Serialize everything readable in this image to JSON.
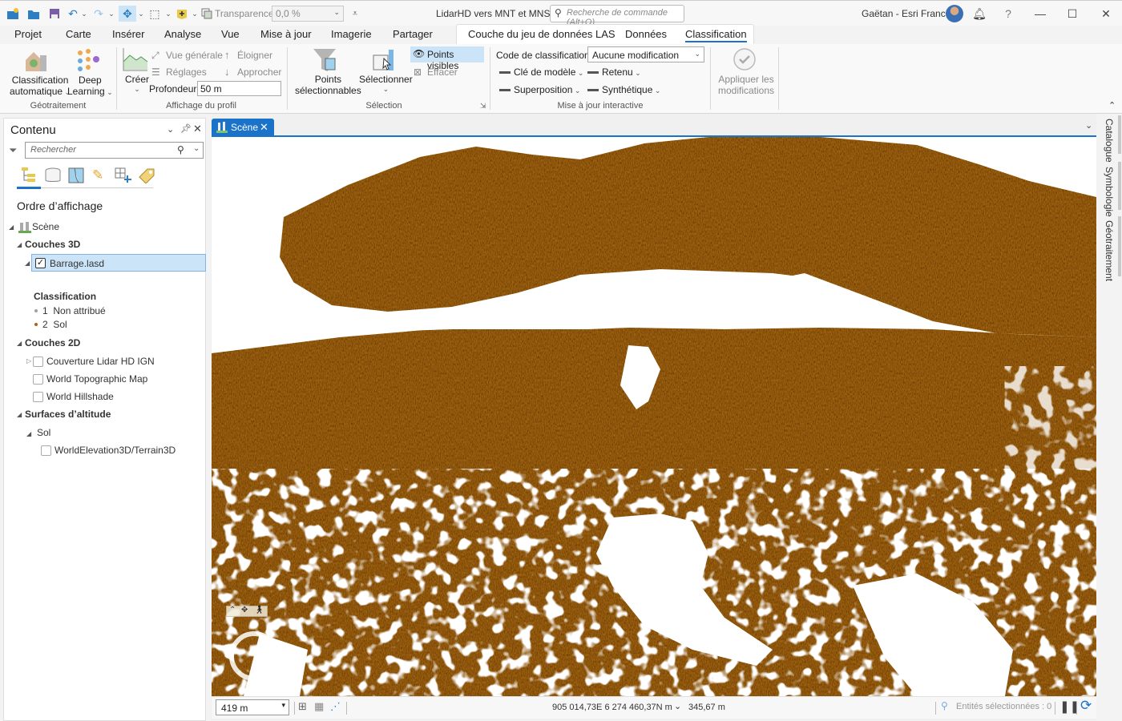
{
  "titlebar": {
    "app_title": "LidarHD vers MNT et MNS",
    "command_search_placeholder": "Recherche de commande (Alt+Q)",
    "transparency_label": "Transparence",
    "transparency_value": "0,0 %",
    "user_name": "Gaëtan - Esri France",
    "icons": [
      "new-project-icon",
      "open-project-icon",
      "save-project-icon",
      "undo-icon",
      "redo-icon",
      "explore-navigate-icon",
      "select-icon",
      "add-data-icon",
      "transparency-icon",
      "customize-toolbar-icon",
      "notifications-icon",
      "help-icon",
      "minimize-icon",
      "maximize-icon",
      "close-icon"
    ]
  },
  "tabs": {
    "main": [
      "Projet",
      "Carte",
      "Insérer",
      "Analyse",
      "Vue",
      "Mise à jour",
      "Imagerie",
      "Partager"
    ],
    "contextual": [
      "Couche du jeu de données LAS",
      "Données",
      "Classification"
    ],
    "active": "Classification"
  },
  "ribbon": {
    "geotraitement": {
      "title": "Géotraitement",
      "classif_auto_1": "Classification",
      "classif_auto_2": "automatique",
      "deep_1": "Deep",
      "deep_2": "Learning"
    },
    "profil": {
      "title": "Affichage du profil",
      "creer": "Créer",
      "vue_generale": "Vue générale",
      "reglages": "Réglages",
      "eloigner": "Éloigner",
      "approcher": "Approcher",
      "profondeur_label": "Profondeur",
      "profondeur_value": "50 m"
    },
    "selection": {
      "title": "Sélection",
      "points_sel_1": "Points",
      "points_sel_2": "sélectionnables",
      "selectionner": "Sélectionner",
      "points_visibles": "Points visibles",
      "effacer": "Effacer"
    },
    "maj": {
      "title": "Mise à jour interactive",
      "code_label": "Code de classification",
      "code_value": "Aucune modification",
      "cle_modele": "Clé de modèle",
      "retenu": "Retenu",
      "superposition": "Superposition",
      "synthetique": "Synthétique"
    },
    "apply_1": "Appliquer les",
    "apply_2": "modifications"
  },
  "contents": {
    "title": "Contenu",
    "search_placeholder": "Rechercher",
    "section_title": "Ordre d’affichage",
    "scene": "Scène",
    "couches3d": "Couches 3D",
    "layer_las": "Barrage.lasd",
    "layer_las_checked": true,
    "legend_title": "Classification",
    "legend": [
      {
        "code": "1",
        "label": "Non attribué",
        "color": "#a0a0a0"
      },
      {
        "code": "2",
        "label": "Sol",
        "color": "#a8660d"
      }
    ],
    "couches2d": "Couches 2D",
    "layers2d": [
      {
        "label": "Couverture Lidar HD IGN",
        "checked": false
      },
      {
        "label": "World Topographic Map",
        "checked": false
      },
      {
        "label": "World Hillshade",
        "checked": false
      }
    ],
    "surfaces": "Surfaces d’altitude",
    "sol": "Sol",
    "terrain": "WorldElevation3D/Terrain3D"
  },
  "view": {
    "tab_label": "Scène",
    "scale": "419 m",
    "coordinates": "905 014,73E 6 274 460,37N m",
    "elevation": "345,67 m",
    "selected_features": "Entités sélectionnées : 0",
    "point_color": "#a8690f"
  },
  "right_rail": [
    "Catalogue",
    "Symbologie",
    "Géotraitement"
  ]
}
